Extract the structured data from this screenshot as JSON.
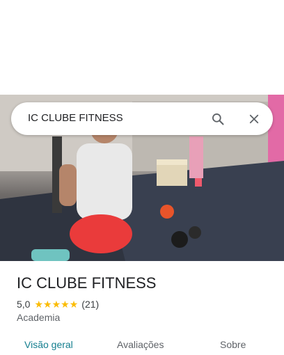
{
  "search": {
    "query": "IC CLUBE FITNESS"
  },
  "icons": {
    "search": "search-icon",
    "close": "close-icon"
  },
  "place": {
    "name": "IC CLUBE FITNESS",
    "rating": "5,0",
    "stars": 5,
    "reviews_count": "(21)",
    "category": "Academia"
  },
  "tabs": [
    {
      "label": "Visão geral",
      "active": true
    },
    {
      "label": "Avaliações",
      "active": false
    },
    {
      "label": "Sobre",
      "active": false
    }
  ],
  "colors": {
    "accent": "#137e8e",
    "star": "#fbbc04",
    "text": "#202124",
    "muted": "#5f6368"
  }
}
